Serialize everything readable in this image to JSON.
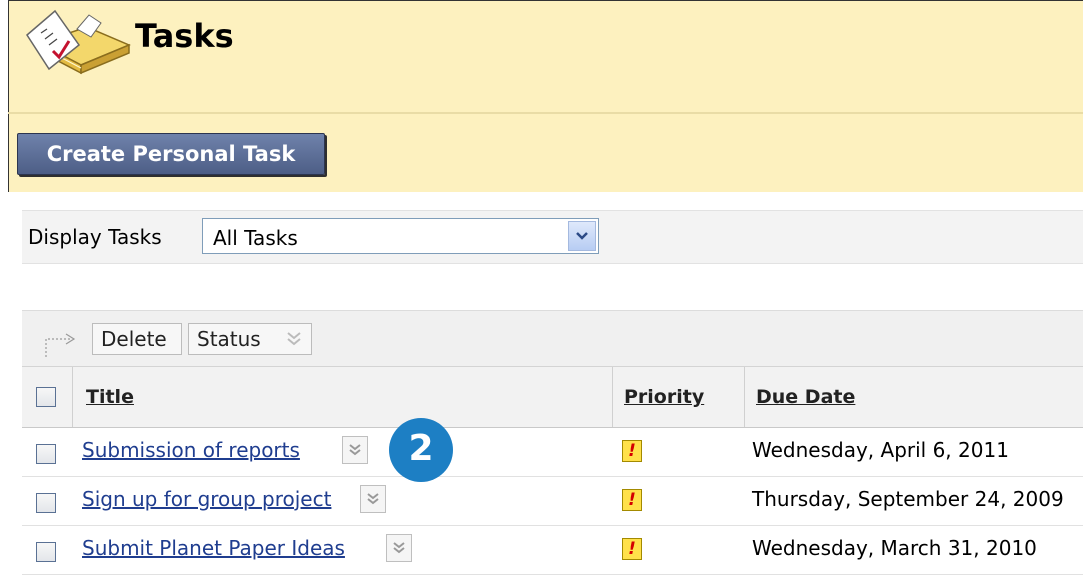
{
  "header": {
    "title": "Tasks",
    "icon": "tasks-notepad-icon"
  },
  "actions": {
    "create_label": "Create Personal Task"
  },
  "filter": {
    "label": "Display Tasks",
    "selected": "All Tasks"
  },
  "toolbar": {
    "delete_label": "Delete",
    "status_label": "Status"
  },
  "table": {
    "columns": [
      "Title",
      "Priority",
      "Due Date"
    ],
    "rows": [
      {
        "title": "Submission of reports",
        "priority": "!",
        "due": "Wednesday, April 6, 2011"
      },
      {
        "title": "Sign up for group project",
        "priority": "!",
        "due": "Thursday, September 24, 2009"
      },
      {
        "title": "Submit Planet Paper Ideas",
        "priority": "!",
        "due": "Wednesday, March 31, 2010"
      }
    ]
  },
  "callout": {
    "number": "2"
  },
  "colors": {
    "header_bg": "#fdf1bf",
    "button_bg": "#5a6b93",
    "link": "#1f3d8f",
    "priority": "#ffe14a",
    "badge": "#1d7fc4"
  }
}
